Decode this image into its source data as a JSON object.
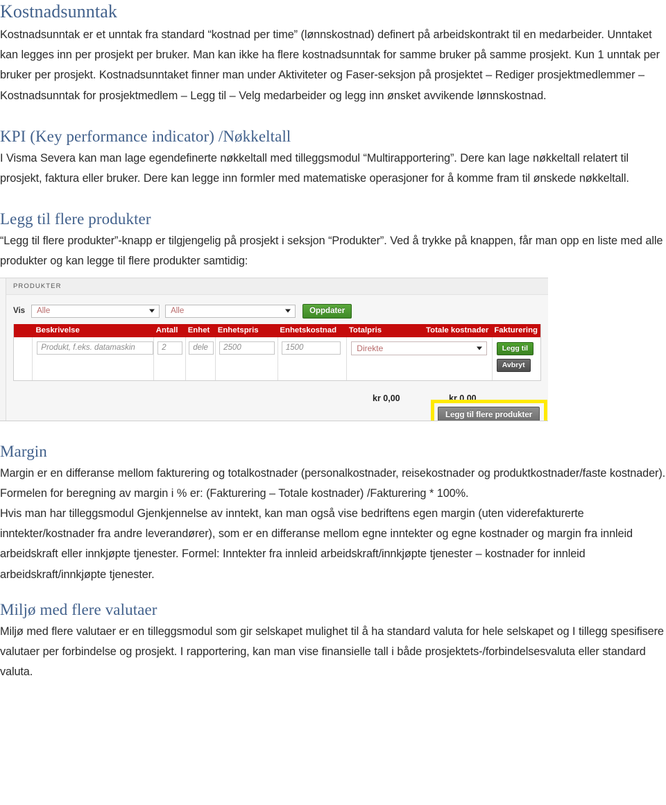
{
  "document": {
    "sections": [
      {
        "id": "kostnadsunntak",
        "heading": "Kostnadsunntak",
        "heading_level": 1,
        "paragraphs": [
          "Kostnadsunntak er et unntak fra standard “kostnad per time” (lønnskostnad) definert på arbeidskontrakt til en medarbeider. Unntaket kan legges inn per prosjekt per bruker. Man kan ikke ha flere kostnadsunntak for samme bruker på samme prosjekt. Kun 1 unntak per bruker per prosjekt. Kostnadsunntaket finner man under Aktiviteter og Faser-seksjon på prosjektet – Rediger prosjektmedlemmer – Kostnadsunntak for prosjektmedlem – Legg til – Velg medarbeider og legg inn ønsket avvikende lønnskostnad."
        ]
      },
      {
        "id": "kpi",
        "heading": "KPI (Key performance indicator) /Nøkkeltall",
        "heading_level": 2,
        "paragraphs": [
          "I Visma Severa kan man lage egendefinerte nøkkeltall med tilleggsmodul “Multirapportering”. Dere kan lage nøkkeltall relatert til prosjekt, faktura eller bruker. Dere kan legge inn formler med matematiske operasjoner for å komme fram til ønskede nøkkeltall."
        ]
      },
      {
        "id": "legg-til-flere-produkter",
        "heading": "Legg til flere produkter",
        "heading_level": 2,
        "paragraphs": [
          "“Legg til flere produkter”-knapp er tilgjengelig på prosjekt i seksjon “Produkter”. Ved å trykke på knappen, får man opp en liste med alle produkter og kan legge til flere produkter samtidig:"
        ]
      },
      {
        "id": "margin",
        "heading": "Margin",
        "heading_level": 2,
        "paragraphs": [
          "Margin er en differanse mellom fakturering og totalkostnader (personalkostnader, reisekostnader og produktkostnader/faste kostnader). Formelen for beregning av margin i % er: (Fakturering – Totale kostnader) /Fakturering * 100%.",
          "Hvis man har tilleggsmodul Gjenkjennelse av inntekt, kan man også vise bedriftens egen margin (uten viderefakturerte inntekter/kostnader fra andre leverandører), som er en differanse mellom egne inntekter og egne kostnader og margin fra innleid arbeidskraft eller innkjøpte tjenester. Formel: Inntekter fra innleid arbeidskraft/innkjøpte tjenester – kostnader for innleid arbeidskraft/innkjøpte tjenester."
        ]
      },
      {
        "id": "miljo-med-flere-valutaer",
        "heading": "Miljø med flere valutaer",
        "heading_level": 2,
        "paragraphs": [
          "Miljø med flere valutaer er en tilleggsmodul som gir selskapet mulighet til å ha standard valuta for hele selskapet og I tillegg spesifisere valutaer per forbindelse og prosjekt. I rapportering, kan man vise finansielle tall i både prosjektets-/forbindelsesvaluta eller standard valuta."
        ]
      }
    ]
  },
  "screenshot": {
    "panel_title": "PRODUKTER",
    "filter": {
      "label": "Vis",
      "select_1_value": "Alle",
      "select_2_value": "Alle",
      "update_button": "Oppdater",
      "caret_icon": "chevron-down-icon"
    },
    "table": {
      "headers": [
        "Beskrivelse",
        "Antall",
        "Enhet",
        "Enhetspris",
        "Enhetskostnad",
        "Totalpris",
        "Totale kostnader",
        "Fakturering"
      ],
      "row": {
        "beskrivelse_placeholder": "Produkt, f.eks. datamaskin",
        "antall": "2",
        "enhet": "dele",
        "enhetspris": "2500",
        "enhetskostnad": "1500",
        "fakturering_value": "Direkte",
        "add_button": "Legg til",
        "cancel_button": "Avbryt"
      }
    },
    "totals": {
      "totalpris": "kr 0,00",
      "totale_kostnader": "kr 0,00"
    },
    "add_more_button": "Legg til flere produkter",
    "colors": {
      "table_header_bg": "#c50b0b",
      "accent_green": "#4fa32f",
      "highlight": "#ffea00",
      "heading_blue": "#42618c"
    }
  }
}
